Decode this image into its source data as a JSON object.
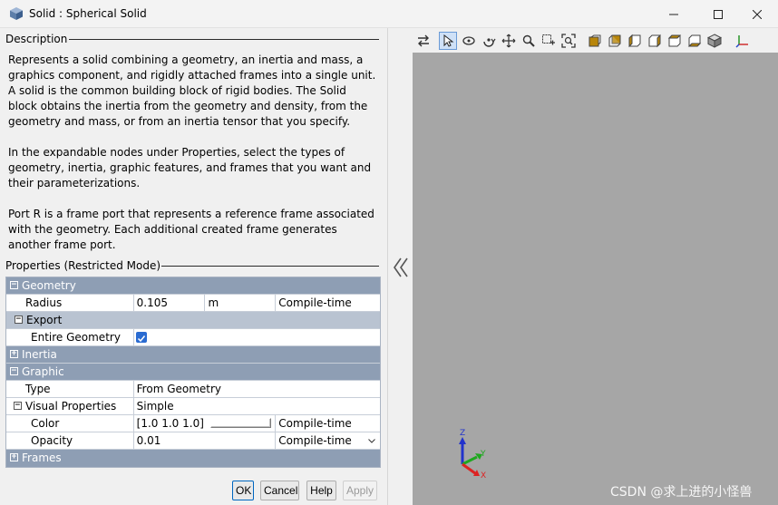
{
  "window": {
    "title": "Solid : Spherical Solid",
    "app_icon": "cube-icon",
    "controls": [
      "minimize-icon",
      "maximize-icon",
      "close-icon"
    ]
  },
  "description": {
    "heading": "Description",
    "paragraphs": [
      "Represents a solid combining a geometry, an inertia and mass, a graphics component, and rigidly attached frames into a single unit. A solid is the common building block of rigid bodies. The Solid block obtains the inertia from the geometry and density, from the geometry and mass, or from an inertia tensor that you specify.",
      "In the expandable nodes under Properties, select the types of geometry, inertia, graphic features, and frames that you want and their parameterizations.",
      "Port R is a frame port that represents a reference frame associated with the geometry. Each additional created frame generates another frame port."
    ]
  },
  "properties": {
    "heading": "Properties (Restricted Mode)",
    "geometry": {
      "label": "Geometry",
      "expander": "−"
    },
    "radius": {
      "label": "Radius",
      "value": "0.105",
      "unit": "m",
      "mode": "Compile-time"
    },
    "export": {
      "label": "Export",
      "expander": "−"
    },
    "entire_geometry": {
      "label": "Entire Geometry",
      "checked": true
    },
    "inertia": {
      "label": "Inertia",
      "expander": "+"
    },
    "graphic": {
      "label": "Graphic",
      "expander": "−"
    },
    "type": {
      "label": "Type",
      "value": "From Geometry"
    },
    "visual_properties": {
      "label": "Visual Properties",
      "value": "Simple",
      "expander": "−"
    },
    "color": {
      "label": "Color",
      "value": "[1.0 1.0 1.0]",
      "mode": "Compile-time"
    },
    "opacity": {
      "label": "Opacity",
      "value": "0.01",
      "mode": "Compile-time"
    },
    "frames": {
      "label": "Frames",
      "expander": "+"
    }
  },
  "buttons": {
    "ok": "OK",
    "cancel": "Cancel",
    "help": "Help",
    "apply": "Apply"
  },
  "viewer": {
    "toolbar_icons": [
      "swap-arrows-icon",
      "select-pointer-icon",
      "rotate-icon",
      "spin-icon",
      "pan-icon",
      "zoom-icon",
      "zoom-box-icon",
      "fit-to-view-icon",
      "front-view-icon",
      "back-view-icon",
      "left-view-icon",
      "right-view-icon",
      "top-view-icon",
      "bottom-view-icon",
      "isometric-view-icon",
      "frame-axes-icon"
    ],
    "triad": {
      "x": "X",
      "y": "Y",
      "z": "Z"
    },
    "watermark": "CSDN @求上进的小怪兽"
  },
  "colors": {
    "group_header": "#8e9eb4",
    "subgroup_header": "#b9c3d1",
    "viewport_bg": "#a6a6a6",
    "accent": "#2a6bd1"
  }
}
